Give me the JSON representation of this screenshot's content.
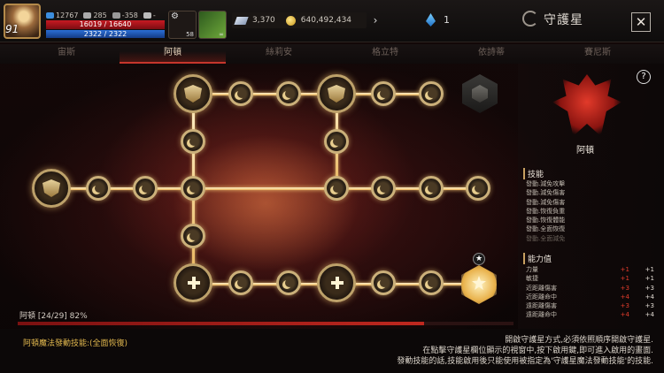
{
  "player": {
    "level": "91",
    "stat1": "12767",
    "stat2": "285",
    "stat3": "-358",
    "stat4": "-",
    "hp": "16019 / 16640",
    "mp": "2322 / 2322",
    "slot1_count": "58",
    "slot2_count": "∞"
  },
  "currency": {
    "feather": "3,370",
    "gold": "640,492,434",
    "gem": "1"
  },
  "header": {
    "title": "守護星",
    "close": "✕",
    "arrow": "›"
  },
  "tabs": [
    {
      "label": "宙斯"
    },
    {
      "label": "阿頓"
    },
    {
      "label": "絲莉安"
    },
    {
      "label": "格立特"
    },
    {
      "label": "依詩蒂"
    },
    {
      "label": "賽尼斯"
    }
  ],
  "progress": {
    "label": "阿頓 [24/29] 82%",
    "fraction": 0.82
  },
  "bottom": {
    "skill": "阿頓魔法發動技能:(全面恢復)",
    "instr1": "開啟守護星方式,必須依照順序開啟守護星.",
    "instr2": "在點擊守護星欄位顯示的視窗中,按下啟用鍵,即可進入啟用的畫面.",
    "instr3": "發動技能的話,技能啟用後只能使用被指定為'守護星魔法發動技能'的技能."
  },
  "panel": {
    "help": "?",
    "name": "阿頓",
    "skills_title": "技能",
    "skills": [
      "發動.減免攻擊",
      "發動.減免傷害",
      "發動.減免傷害",
      "發動.恢復負重",
      "發動.恢復體能",
      "發動.全面恢復",
      "發動.全面減免"
    ],
    "stats_title": "能力值",
    "stats": [
      {
        "name": "力量",
        "add": "+1",
        "val": "+1"
      },
      {
        "name": "敏捷",
        "add": "+1",
        "val": "+1"
      },
      {
        "name": "近距離傷害",
        "add": "+3",
        "val": "+3"
      },
      {
        "name": "近距離命中",
        "add": "+4",
        "val": "+4"
      },
      {
        "name": "遠距離傷害",
        "add": "+3",
        "val": "+3"
      },
      {
        "name": "遠距離命中",
        "add": "+4",
        "val": "+4"
      }
    ]
  },
  "icons": {
    "avatar": "avatar-portrait",
    "feather": "feather-icon",
    "gold": "gold-coin-icon",
    "gem": "blue-gem-icon",
    "logo": "guardian-star-logo",
    "star_badge": "star-icon"
  },
  "colors": {
    "accent_red": "#c6362c",
    "gold": "#e2b84e",
    "stat_add": "#e23c2c"
  }
}
